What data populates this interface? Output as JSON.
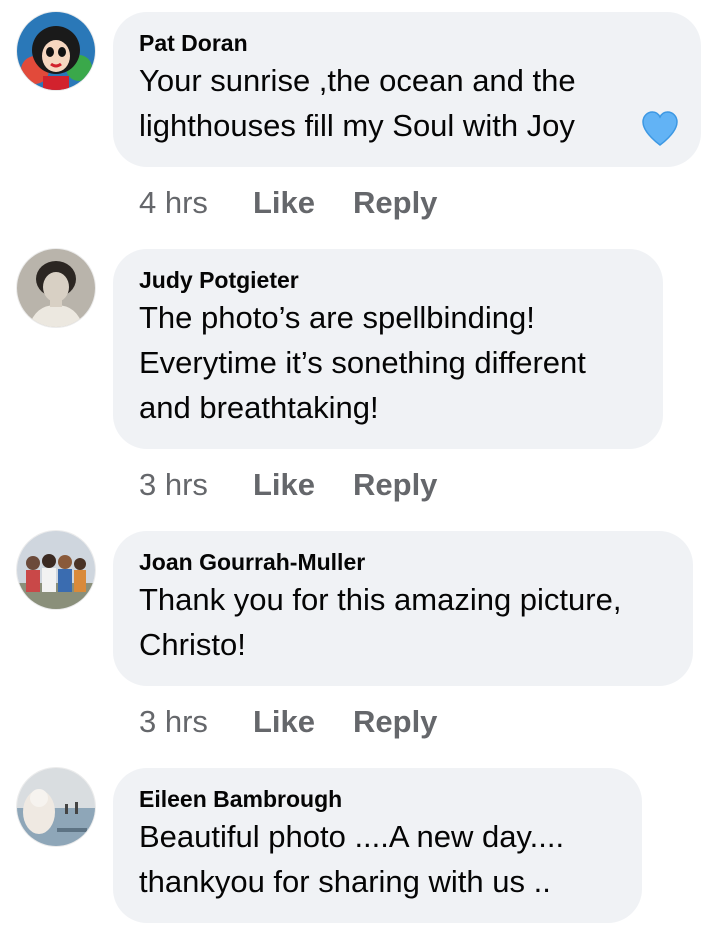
{
  "colors": {
    "bubble_bg": "#f0f2f5",
    "meta_text": "#65676b",
    "heart": "#62b3f5"
  },
  "comments": [
    {
      "author": "Pat Doran",
      "text": "Your sunrise ,the ocean and the\nlighthouses fill my Soul with Joy",
      "emoji": "blue-heart-icon",
      "time": "4 hrs",
      "like_label": "Like",
      "reply_label": "Reply"
    },
    {
      "author": "Judy Potgieter",
      "text": "The photo’s are spellbinding!\nEverytime it’s sonething different\nand breathtaking!",
      "time": "3 hrs",
      "like_label": "Like",
      "reply_label": "Reply"
    },
    {
      "author": "Joan Gourrah-Muller",
      "text": "Thank you for this amazing picture,\nChristo!",
      "time": "3 hrs",
      "like_label": "Like",
      "reply_label": "Reply"
    },
    {
      "author": "Eileen Bambrough",
      "text": "Beautiful photo ....A new day....\nthankyou for sharing with us    ..",
      "time": "",
      "like_label": "",
      "reply_label": ""
    }
  ]
}
